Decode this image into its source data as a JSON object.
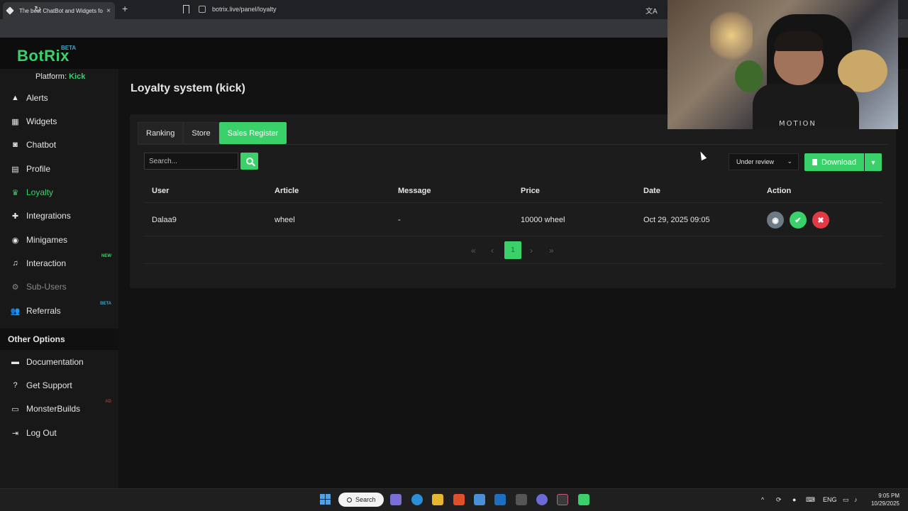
{
  "browser": {
    "tab_title": "The best ChatBot and Widgets fo",
    "tab_close": "×",
    "new_tab": "+",
    "url": "botrix.live/panel/loyalty"
  },
  "app": {
    "logo": "BotRix",
    "logo_badge": "BETA",
    "platform_label": "Platform:",
    "platform_value": "Kick"
  },
  "sidebar": {
    "items": [
      {
        "label": "Alerts",
        "icon": "warning-icon"
      },
      {
        "label": "Widgets",
        "icon": "grid-icon"
      },
      {
        "label": "Chatbot",
        "icon": "robot-icon"
      },
      {
        "label": "Profile",
        "icon": "id-card-icon"
      },
      {
        "label": "Loyalty",
        "icon": "trophy-icon",
        "active": true
      },
      {
        "label": "Integrations",
        "icon": "puzzle-icon"
      },
      {
        "label": "Minigames",
        "icon": "gamepad-icon"
      },
      {
        "label": "Interaction",
        "icon": "music-icon",
        "badge": "NEW"
      },
      {
        "label": "Sub-Users",
        "icon": "users-cog-icon",
        "disabled": true
      },
      {
        "label": "Referrals",
        "icon": "user-group-icon",
        "badge": "BETA"
      }
    ],
    "other_header": "Other Options",
    "other_items": [
      {
        "label": "Documentation",
        "icon": "book-icon"
      },
      {
        "label": "Get Support",
        "icon": "question-icon"
      },
      {
        "label": "MonsterBuilds",
        "icon": "laptop-icon",
        "badge": "AD"
      },
      {
        "label": "Log Out",
        "icon": "logout-icon"
      }
    ]
  },
  "page": {
    "title": "Loyalty system (kick)",
    "tabs": [
      "Ranking",
      "Store",
      "Sales Register"
    ],
    "active_tab": "Sales Register",
    "search_placeholder": "Search...",
    "status_filter": "Under review",
    "download_label": "Download",
    "table": {
      "headers": [
        "User",
        "Article",
        "Message",
        "Price",
        "Date",
        "Action"
      ],
      "rows": [
        {
          "user": "Dalaa9",
          "article": "wheel",
          "message": "-",
          "price": "10000 wheel",
          "date": "Oct 29, 2025 09:05"
        }
      ]
    },
    "pagination": {
      "first": "«",
      "prev": "‹",
      "current": "1",
      "next": "›",
      "last": "»"
    }
  },
  "webcam": {
    "shirt_text": "MOTION"
  },
  "taskbar": {
    "search_label": "Search",
    "lang": "ENG",
    "time": "9:05 PM",
    "date": "10/29/2025"
  },
  "colors": {
    "accent": "#3ad16b",
    "beta": "#3aa7c9",
    "danger": "#e23a45",
    "view": "#6c7a85"
  }
}
